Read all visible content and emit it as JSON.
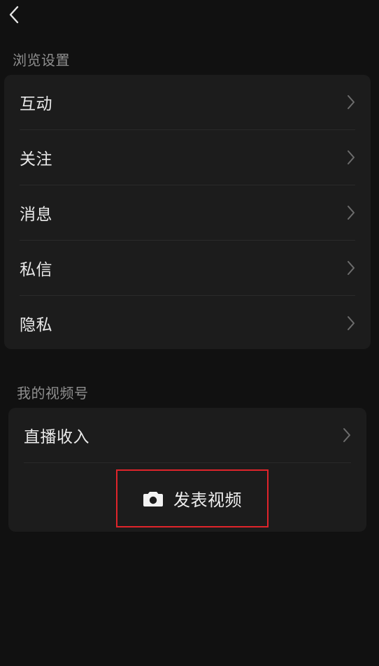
{
  "header": {
    "back_icon": "chevron-left-icon"
  },
  "browse_settings": {
    "title": "浏览设置",
    "items": [
      {
        "label": "互动"
      },
      {
        "label": "关注"
      },
      {
        "label": "消息"
      },
      {
        "label": "私信"
      },
      {
        "label": "隐私"
      }
    ]
  },
  "channel": {
    "title": "我的视频号",
    "items": [
      {
        "label": "直播收入"
      }
    ],
    "publish": {
      "label": "发表视频",
      "icon": "camera-icon"
    }
  },
  "colors": {
    "background": "#111111",
    "card": "#1c1c1c",
    "highlight_border": "#e0242b"
  }
}
